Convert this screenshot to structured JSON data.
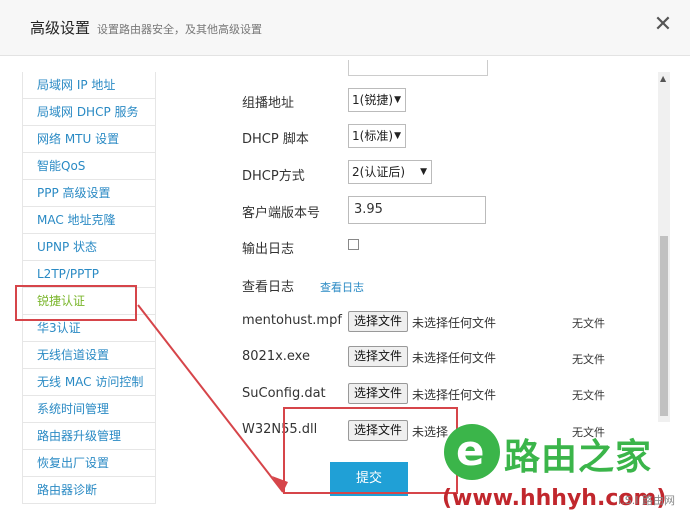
{
  "header": {
    "title": "高级设置",
    "subtitle": "设置路由器安全，及其他高级设置",
    "close_icon": "✕"
  },
  "sidebar": {
    "items": [
      {
        "label": "局域网 IP 地址"
      },
      {
        "label": "局域网 DHCP 服务"
      },
      {
        "label": "网络 MTU 设置"
      },
      {
        "label": "智能QoS"
      },
      {
        "label": "PPP 高级设置"
      },
      {
        "label": "MAC 地址克隆"
      },
      {
        "label": "UPNP 状态"
      },
      {
        "label": "L2TP/PPTP"
      },
      {
        "label": "锐捷认证",
        "active": true
      },
      {
        "label": "华3认证"
      },
      {
        "label": "无线信道设置"
      },
      {
        "label": "无线 MAC 访问控制"
      },
      {
        "label": "系统时间管理"
      },
      {
        "label": "路由器升级管理"
      },
      {
        "label": "恢复出厂设置"
      },
      {
        "label": "路由器诊断"
      }
    ],
    "active_color": "#7ab62b",
    "link_color": "#2a8ac4"
  },
  "form": {
    "multicast": {
      "label": "组播地址",
      "value": "1(锐捷)"
    },
    "dhcp_script": {
      "label": "DHCP 脚本",
      "value": "1(标准)"
    },
    "dhcp_mode": {
      "label": "DHCP方式",
      "value": "2(认证后)"
    },
    "client_version": {
      "label": "客户端版本号",
      "value": "3.95"
    },
    "output_log": {
      "label": "输出日志",
      "checked": false
    },
    "view_log": {
      "label": "查看日志",
      "link": "查看日志"
    },
    "files": [
      {
        "name": "mentohust.mpf",
        "button": "选择文件",
        "chosen": "未选择任何文件",
        "status": "无文件"
      },
      {
        "name": "8021x.exe",
        "button": "选择文件",
        "chosen": "未选择任何文件",
        "status": "无文件"
      },
      {
        "name": "SuConfig.dat",
        "button": "选择文件",
        "chosen": "未选择任何文件",
        "status": "无文件"
      },
      {
        "name": "W32N55.dll",
        "button": "选择文件",
        "chosen": "未选择",
        "status": "无文件"
      }
    ],
    "submit_label": "提交"
  },
  "colors": {
    "accent": "#20a0d6",
    "annotation": "#d6454a"
  },
  "watermark": {
    "name": "路由之家",
    "url": "(www.hhhyh.com)",
    "tag": "I.S.I 路由网"
  }
}
